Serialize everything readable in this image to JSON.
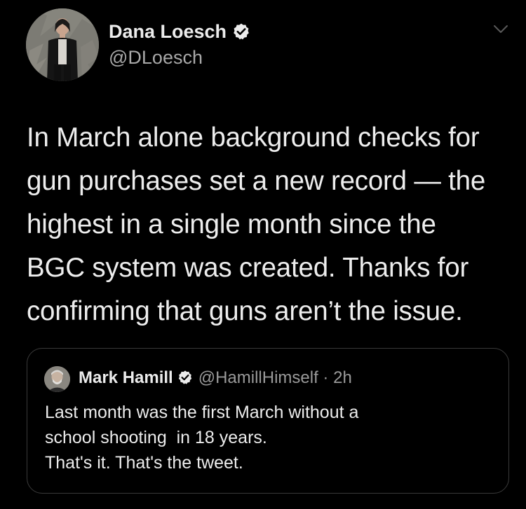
{
  "tweet": {
    "author_name": "Dana Loesch",
    "author_handle": "@DLoesch",
    "text_lines": [
      "In March alone background checks for",
      "gun purchases set a new record — the",
      "highest in a single month since the",
      "BGC system was created. Thanks for",
      "confirming that guns aren’t the issue."
    ]
  },
  "quoted_tweet": {
    "author_name": "Mark Hamill",
    "author_handle": "@HamillHimself",
    "separator": " · ",
    "time": "2h",
    "text_lines": [
      "Last month was the first March without a",
      "school shooting  in 18 years.",
      "That's it. That's the tweet."
    ]
  },
  "icons": {
    "verified": "verified-badge-icon",
    "menu": "chevron-down-icon"
  },
  "colors": {
    "background": "#000000",
    "primary_text": "#ececec",
    "secondary_text": "#a8a8a8",
    "border": "#3a3a3a"
  }
}
